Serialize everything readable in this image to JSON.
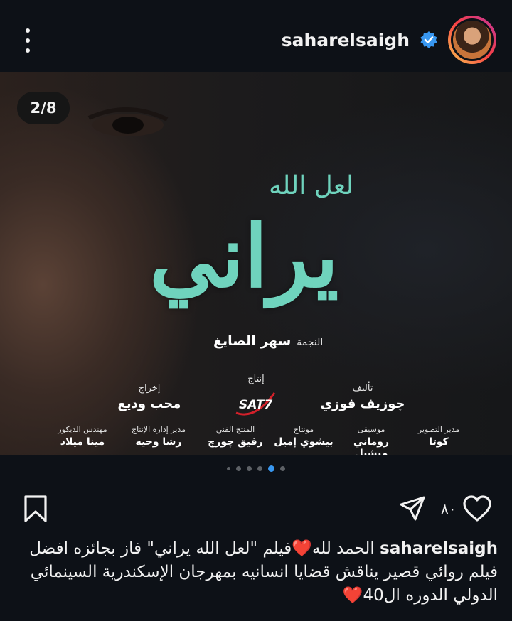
{
  "header": {
    "username": "saharelsaigh",
    "menu_icon": "more-vertical-icon",
    "verified_icon": "verified-badge-icon"
  },
  "post": {
    "counter": "2/8",
    "poster": {
      "title_small": "لعل الله",
      "title_big": "يراني",
      "star_label": "النجمة",
      "star_name": "سهر الصايغ",
      "credits": {
        "writer": {
          "role": "تأليف",
          "name": "چوزيف فوزي"
        },
        "production": {
          "role": "إنتاج",
          "logo": "SAT7"
        },
        "director": {
          "role": "إخراج",
          "name": "محب وديع"
        },
        "cinematographer": {
          "role": "مدير التصوير",
          "name": "كوتا"
        },
        "music": {
          "role": "موسيقى",
          "name": "روماني ميشيل"
        },
        "editor": {
          "role": "مونتاج",
          "name": "بيشوي إميل"
        },
        "art_producer": {
          "role": "المنتج الفني",
          "name": "رفيق چورچ"
        },
        "production_manager": {
          "role": "مدير إدارة الإنتاج",
          "name": "رشا وجيه"
        },
        "decor_engineer": {
          "role": "مهندس الديكور",
          "name": "مينا ميلاد"
        }
      }
    }
  },
  "carousel": {
    "count": 6,
    "active_index": 4
  },
  "actions": {
    "likes": "٨٠",
    "save_icon": "bookmark-icon",
    "share_icon": "send-icon",
    "like_icon": "heart-icon"
  },
  "caption": {
    "username": "saharelsaigh",
    "part1": " الحمد لله",
    "part2": "فيلم \"لعل الله يراني\" فاز بجائزه افضل فيلم روائي قصير يناقش قضايا انسانيه بمهرجان الإسكندرية السينمائي الدولي الدوره ال40",
    "heart_emoji": "❤️"
  },
  "colors": {
    "background": "#0d1117",
    "accent_blue": "#3897f0",
    "title_teal": "#6fd3bd",
    "heart_red": "#e3152d"
  }
}
